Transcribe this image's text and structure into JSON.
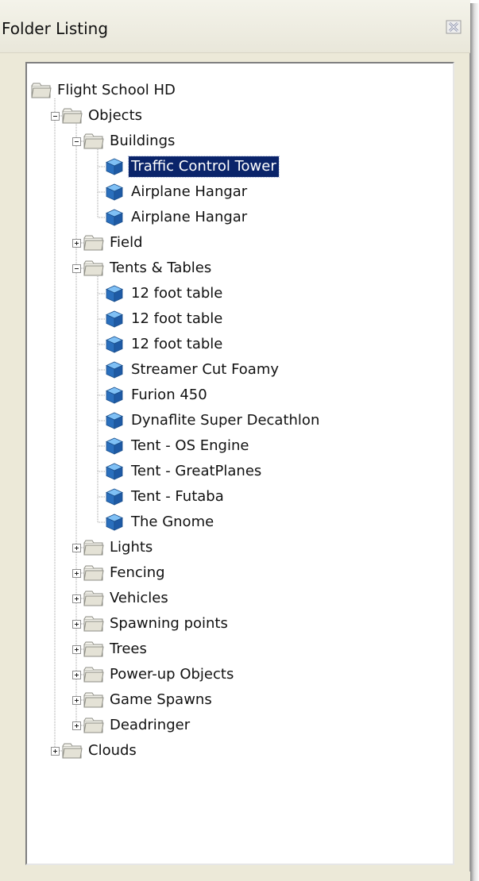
{
  "window": {
    "title": "Folder Listing",
    "close_icon": "close-x-icon"
  },
  "tree": [
    {
      "label": "Flight School HD",
      "type": "folder",
      "level": 0,
      "expander": "none"
    },
    {
      "label": "Objects",
      "type": "folder",
      "level": 1,
      "expander": "minus"
    },
    {
      "label": "Buildings",
      "type": "folder",
      "level": 2,
      "expander": "minus"
    },
    {
      "label": "Traffic Control Tower",
      "type": "object",
      "level": 3,
      "selected": true
    },
    {
      "label": "Airplane Hangar",
      "type": "object",
      "level": 3
    },
    {
      "label": "Airplane Hangar",
      "type": "object",
      "level": 3
    },
    {
      "label": "Field",
      "type": "folder",
      "level": 2,
      "expander": "plus"
    },
    {
      "label": "Tents & Tables",
      "type": "folder",
      "level": 2,
      "expander": "minus"
    },
    {
      "label": "12 foot table",
      "type": "object",
      "level": 3
    },
    {
      "label": "12 foot table",
      "type": "object",
      "level": 3
    },
    {
      "label": "12 foot table",
      "type": "object",
      "level": 3
    },
    {
      "label": "Streamer Cut Foamy",
      "type": "object",
      "level": 3
    },
    {
      "label": "Furion 450",
      "type": "object",
      "level": 3
    },
    {
      "label": "Dynaflite Super Decathlon",
      "type": "object",
      "level": 3
    },
    {
      "label": "Tent - OS Engine",
      "type": "object",
      "level": 3
    },
    {
      "label": "Tent - GreatPlanes",
      "type": "object",
      "level": 3
    },
    {
      "label": "Tent - Futaba",
      "type": "object",
      "level": 3
    },
    {
      "label": "The Gnome",
      "type": "object",
      "level": 3
    },
    {
      "label": "Lights",
      "type": "folder",
      "level": 2,
      "expander": "plus"
    },
    {
      "label": "Fencing",
      "type": "folder",
      "level": 2,
      "expander": "plus"
    },
    {
      "label": "Vehicles",
      "type": "folder",
      "level": 2,
      "expander": "plus"
    },
    {
      "label": "Spawning points",
      "type": "folder",
      "level": 2,
      "expander": "plus"
    },
    {
      "label": "Trees",
      "type": "folder",
      "level": 2,
      "expander": "plus"
    },
    {
      "label": "Power-up Objects",
      "type": "folder",
      "level": 2,
      "expander": "plus"
    },
    {
      "label": "Game Spawns",
      "type": "folder",
      "level": 2,
      "expander": "plus"
    },
    {
      "label": "Deadringer",
      "type": "folder",
      "level": 2,
      "expander": "plus"
    },
    {
      "label": "Clouds",
      "type": "folder",
      "level": 1,
      "expander": "plus"
    }
  ],
  "colors": {
    "selection": "#0a246a",
    "folder": "#e8e6dc",
    "object_cube": "#2f7fd0"
  }
}
